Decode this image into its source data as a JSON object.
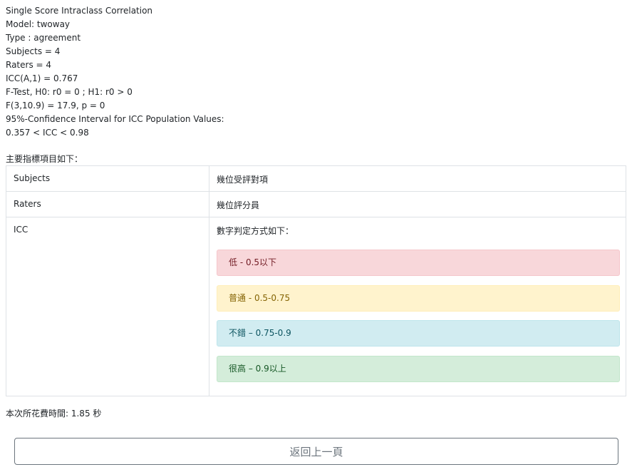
{
  "result_lines": [
    "Single Score Intraclass Correlation",
    "Model: twoway",
    "Type : agreement",
    "Subjects = 4",
    "Raters = 4",
    "ICC(A,1) = 0.767",
    "F-Test, H0: r0 = 0 ; H1: r0 > 0",
    "F(3,10.9) = 17.9, p = 0",
    "95%-Confidence Interval for ICC Population Values:",
    "0.357 < ICC < 0.98"
  ],
  "indicator_table": {
    "heading": "主要指標項目如下：",
    "rows": [
      {
        "term": "Subjects",
        "description": "幾位受評對項"
      },
      {
        "term": "Raters",
        "description": "幾位評分員"
      },
      {
        "term": "ICC",
        "description": "數字判定方式如下："
      }
    ],
    "levels": [
      {
        "label": "低 - 0.5以下",
        "style": "danger",
        "color": "#f8d7da"
      },
      {
        "label": "普通 - 0.5-0.75",
        "style": "warning",
        "color": "#fff3cd"
      },
      {
        "label": "不錯 – 0.75-0.9",
        "style": "info",
        "color": "#d1ecf1"
      },
      {
        "label": "很高 – 0.9以上",
        "style": "success",
        "color": "#d4edda"
      }
    ]
  },
  "elapsed_text": "本次所花費時間: 1.85 秒",
  "back_button_label": "返回上一頁"
}
